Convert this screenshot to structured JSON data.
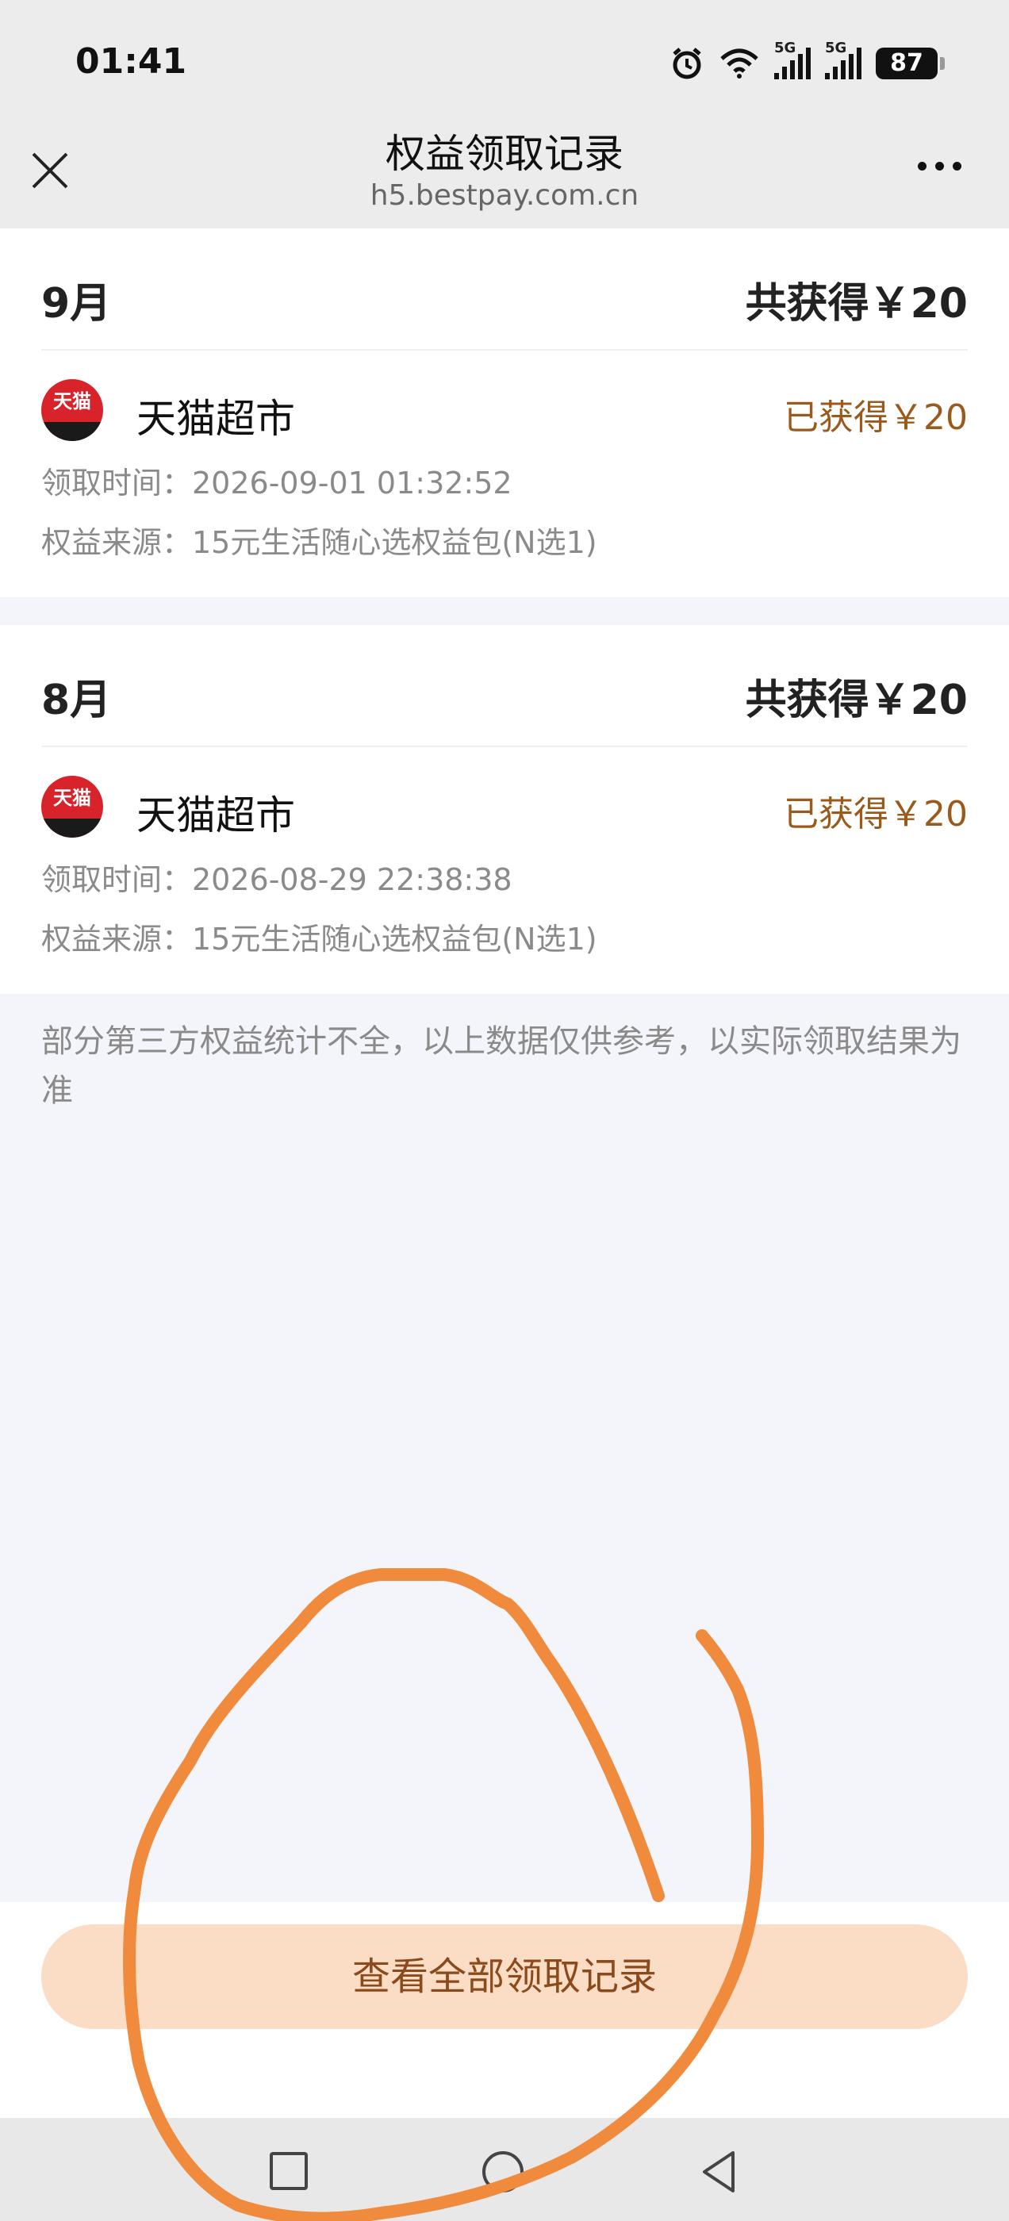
{
  "status_bar": {
    "time": "01:41",
    "network1": "5G",
    "network2": "5G",
    "battery": "87"
  },
  "header": {
    "title": "权益领取记录",
    "domain": "h5.bestpay.com.cn"
  },
  "records": [
    {
      "month": "9月",
      "total": "共获得￥20",
      "merchant": "天猫超市",
      "logo_text": "天猫",
      "obtained": "已获得￥20",
      "time": "领取时间：2026-09-01 01:32:52",
      "source": "权益来源：15元生活随心选权益包(N选1)"
    },
    {
      "month": "8月",
      "total": "共获得￥20",
      "merchant": "天猫超市",
      "logo_text": "天猫",
      "obtained": "已获得￥20",
      "time": "领取时间：2026-08-29 22:38:38",
      "source": "权益来源：15元生活随心选权益包(N选1)"
    }
  ],
  "note": "部分第三方权益统计不全，以上数据仅供参考，以实际领取结果为准",
  "view_all_button": "查看全部领取记录",
  "colors": {
    "accent_text": "#9a5a1c",
    "button_bg": "#fbdcc4",
    "logo_red": "#d8232a",
    "annotation": "#f08a3c"
  }
}
